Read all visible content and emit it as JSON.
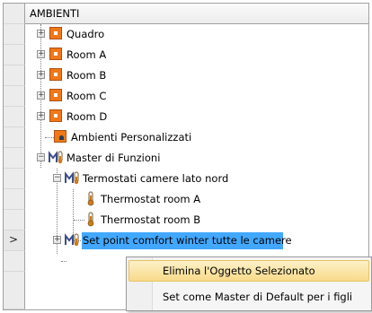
{
  "grid": {
    "column_header": "AMBIENTI",
    "current_row_marker": ">"
  },
  "tree": {
    "items": [
      {
        "label": "Quadro",
        "icon": "room-folder-icon",
        "expander": "+"
      },
      {
        "label": "Room A",
        "icon": "room-folder-icon",
        "expander": "+"
      },
      {
        "label": "Room B",
        "icon": "room-folder-icon",
        "expander": "+"
      },
      {
        "label": "Room C",
        "icon": "room-folder-icon",
        "expander": "+"
      },
      {
        "label": "Room D",
        "icon": "room-folder-icon",
        "expander": "+"
      },
      {
        "label": "Ambienti Personalizzati",
        "icon": "custom-room-icon"
      },
      {
        "label": "Master di Funzioni",
        "icon": "master-functions-icon",
        "expander": "−"
      },
      {
        "label": "Termostati camere lato nord",
        "icon": "master-functions-icon",
        "expander": "−"
      },
      {
        "label": "Thermostat room A",
        "icon": "thermometer-icon"
      },
      {
        "label": "Thermostat room B",
        "icon": "thermometer-icon"
      },
      {
        "label": "Set point comfort winter tutte le camere",
        "icon": "master-functions-icon",
        "expander": "+",
        "selected": true
      }
    ]
  },
  "context_menu": {
    "items": [
      {
        "label": "Elimina l'Oggetto Selezionato",
        "highlighted": true
      },
      {
        "label": "Set come Master di Default per i figli",
        "highlighted": false
      }
    ]
  },
  "colors": {
    "selection": "#42a8ff",
    "menu_highlight": "#f8da8a",
    "room_icon": "#f07818"
  }
}
